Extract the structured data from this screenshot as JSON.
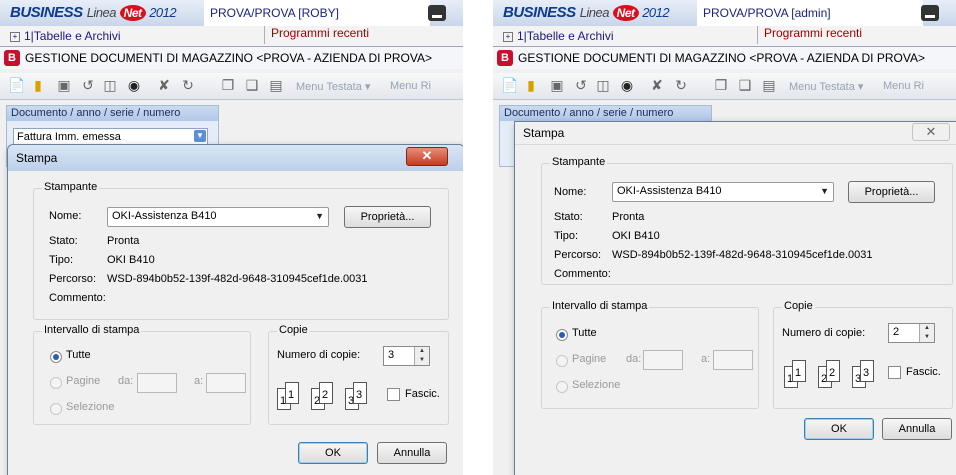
{
  "app": {
    "brand": "BUSINESS",
    "brand_linea": "Linea",
    "brand_net": "Net",
    "brand_year": "2012"
  },
  "panels": [
    {
      "user_label": "PROVA/PROVA [ROBY]",
      "tree_item": "1|Tabelle e Archivi",
      "recent_header": "Programmi recenti",
      "main_title": "GESTIONE DOCUMENTI DI MAGAZZINO <PROVA - AZIENDA DI PROVA>",
      "toolbar_menus": [
        "Menu Testata ▾",
        "Menu Ri"
      ],
      "doc_header": "Documento / anno / serie / numero",
      "doc_value": "Fattura Imm. emessa",
      "dialog": {
        "title": "Stampa",
        "close": "✕",
        "printer_group": "Stampante",
        "name_label": "Nome:",
        "name_value": "OKI-Assistenza B410",
        "properties_button": "Proprietà...",
        "stato_label": "Stato:",
        "stato_value": "Pronta",
        "tipo_label": "Tipo:",
        "tipo_value": "OKI B410",
        "percorso_label": "Percorso:",
        "percorso_value": "WSD-894b0b52-139f-482d-9648-310945cef1de.0031",
        "commento_label": "Commento:",
        "range_group": "Intervallo di stampa",
        "tutte": "Tutte",
        "pagine": "Pagine",
        "da": "da:",
        "a": "a:",
        "selezione": "Selezione",
        "copies_group": "Copie",
        "copies_label": "Numero di copie:",
        "copies_value": "3",
        "collate": "Fascic.",
        "ok": "OK",
        "cancel": "Annulla"
      }
    },
    {
      "user_label": "PROVA/PROVA [admin]",
      "tree_item": "1|Tabelle e Archivi",
      "recent_header": "Programmi recenti",
      "main_title": "GESTIONE DOCUMENTI DI MAGAZZINO <PROVA - AZIENDA DI PROVA>",
      "toolbar_menus": [
        "Menu Testata ▾",
        "Menu Ri"
      ],
      "doc_header": "Documento / anno / serie / numero",
      "doc_value": "",
      "dialog": {
        "title": "Stampa",
        "close": "✕",
        "printer_group": "Stampante",
        "name_label": "Nome:",
        "name_value": "OKI-Assistenza B410",
        "properties_button": "Proprietà...",
        "stato_label": "Stato:",
        "stato_value": "Pronta",
        "tipo_label": "Tipo:",
        "tipo_value": "OKI B410",
        "percorso_label": "Percorso:",
        "percorso_value": "WSD-894b0b52-139f-482d-9648-310945cef1de.0031",
        "commento_label": "Commento:",
        "range_group": "Intervallo di stampa",
        "tutte": "Tutte",
        "pagine": "Pagine",
        "da": "da:",
        "a": "a:",
        "selezione": "Selezione",
        "copies_group": "Copie",
        "copies_label": "Numero di copie:",
        "copies_value": "2",
        "collate": "Fascic.",
        "ok": "OK",
        "cancel": "Annulla"
      }
    }
  ],
  "collate_icons": {
    "pages": [
      "1",
      "1",
      "2",
      "2",
      "3",
      "3"
    ]
  },
  "icons": [
    "new-doc-icon",
    "open-folder-icon",
    "save-icon",
    "undo-icon",
    "delete-icon",
    "binoculars-icon",
    "cut-icon",
    "redo-icon",
    "copy-icon",
    "paste-icon",
    "page-icon"
  ],
  "colors": {
    "brand_blue": "#0d3b8f",
    "brand_red": "#d8101b",
    "recent_header": "#a10000",
    "close_red": "#c63b20"
  }
}
